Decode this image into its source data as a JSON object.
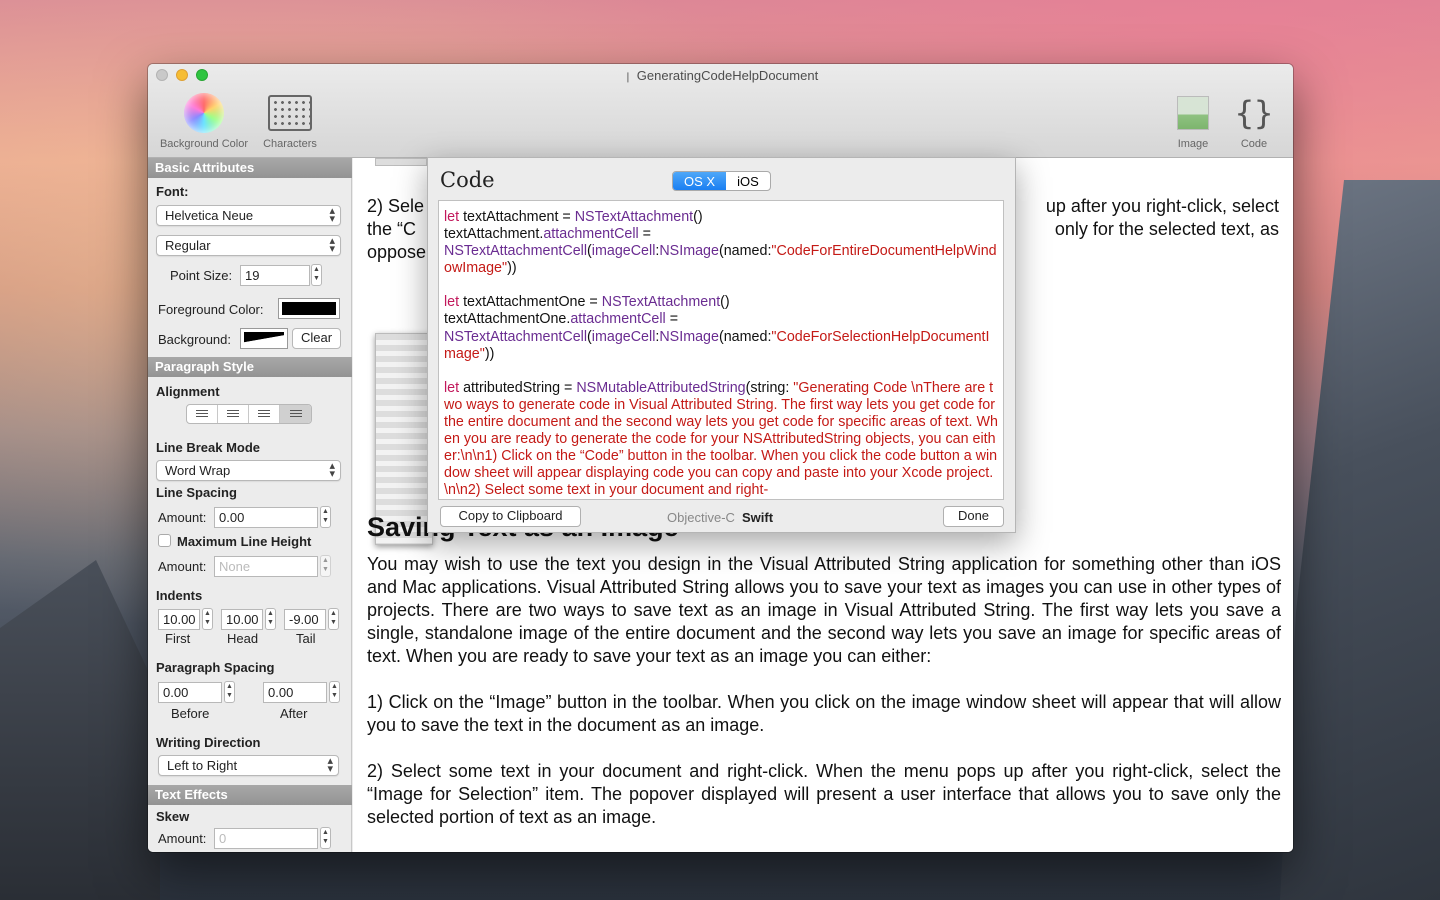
{
  "window": {
    "title": "GeneratingCodeHelpDocument"
  },
  "toolbar": {
    "background_color": "Background Color",
    "characters": "Characters",
    "image": "Image",
    "code": "Code"
  },
  "sidebar": {
    "basic_attributes": "Basic Attributes",
    "font_label": "Font:",
    "font_family": "Helvetica Neue",
    "font_style": "Regular",
    "point_size_label": "Point Size:",
    "point_size": "19",
    "foreground_label": "Foreground Color:",
    "background_label": "Background:",
    "clear": "Clear",
    "paragraph_style": "Paragraph Style",
    "alignment": "Alignment",
    "line_break_mode": "Line Break Mode",
    "line_break_value": "Word Wrap",
    "line_spacing": "Line Spacing",
    "amount_label": "Amount:",
    "line_spacing_amount": "0.00",
    "max_line_height": "Maximum Line Height",
    "max_amount_placeholder": "None",
    "indents": "Indents",
    "indent_first": "10.00",
    "indent_head": "10.00",
    "indent_tail": "-9.00",
    "first_label": "First",
    "head_label": "Head",
    "tail_label": "Tail",
    "paragraph_spacing": "Paragraph Spacing",
    "before_value": "0.00",
    "after_value": "0.00",
    "before_label": "Before",
    "after_label": "After",
    "writing_direction": "Writing Direction",
    "writing_direction_value": "Left to Right",
    "text_effects": "Text Effects",
    "skew": "Skew",
    "skew_placeholder": "0"
  },
  "document": {
    "para_top_a": "2) Sele",
    "para_top_b": "the “C",
    "para_top_c": "oppose",
    "para_top_right1": "up after you right-click, select",
    "para_top_right2": "only for the selected text, as",
    "heading": "Saving Text as an Image",
    "para1": "You may wish to use the text you design in the Visual Attributed String application for something other than iOS and Mac applications. Visual Attributed String allows you to save your text as images you can use in other types of projects. There are two ways to save text as an image in Visual Attributed String. The first way lets you save a single, standalone image of the entire document and the second way lets you save an image for specific areas of text. When you are ready to save your text as an image you can either:",
    "para2": "1) Click on the “Image” button in the toolbar. When you click on the image window sheet will appear that will allow you to save the text in the document as an image.",
    "para3": "2) Select some text in your document and right-click. When the menu pops up after you right-click, select the “Image for Selection” item. The popover displayed will present a user interface that allows you to save only the selected portion of text as an image."
  },
  "sheet": {
    "title": "Code",
    "seg_osx": "OS X",
    "seg_ios": "iOS",
    "copy": "Copy to Clipboard",
    "objc": "Objective-C",
    "swift": "Swift",
    "done": "Done",
    "code": {
      "kw_let": "let",
      "l1_var": " textAttachment = ",
      "l1_type": "NSTextAttachment",
      "l1_end": "()",
      "l2_a": "textAttachment.",
      "l2_b": "attachmentCell",
      "l2_c": " =",
      "l3_type": "NSTextAttachmentCell",
      "l3_open": "(",
      "l3_arg": "imageCell",
      "l3_colon": ":",
      "l3_img": "NSImage",
      "l3_named": "(named:",
      "l3_str": "\"CodeForEntireDocumentHelpWindowImage\"",
      "l3_end": "))",
      "l4_var": " textAttachmentOne = ",
      "l5_a": "textAttachmentOne.",
      "l6_str": "\"CodeForSelectionHelpDocumentImage\"",
      "l7_var": " attributedString = ",
      "l7_type": "NSMutableAttributedString",
      "l7_call": "(string: ",
      "l7_str": "\"Generating Code \\nThere are two ways to generate code in Visual Attributed String. The first way lets you get code for the entire document and the second way lets you get code for specific areas of text.  When you are ready to generate the code for your NSAttributedString objects, you can either:\\n\\n1) Click on the “Code” button in the toolbar. When you click the code button a window sheet will appear displaying code you can copy and paste into your Xcode project. \\n\\n2) Select some text in your document and right-"
    }
  }
}
